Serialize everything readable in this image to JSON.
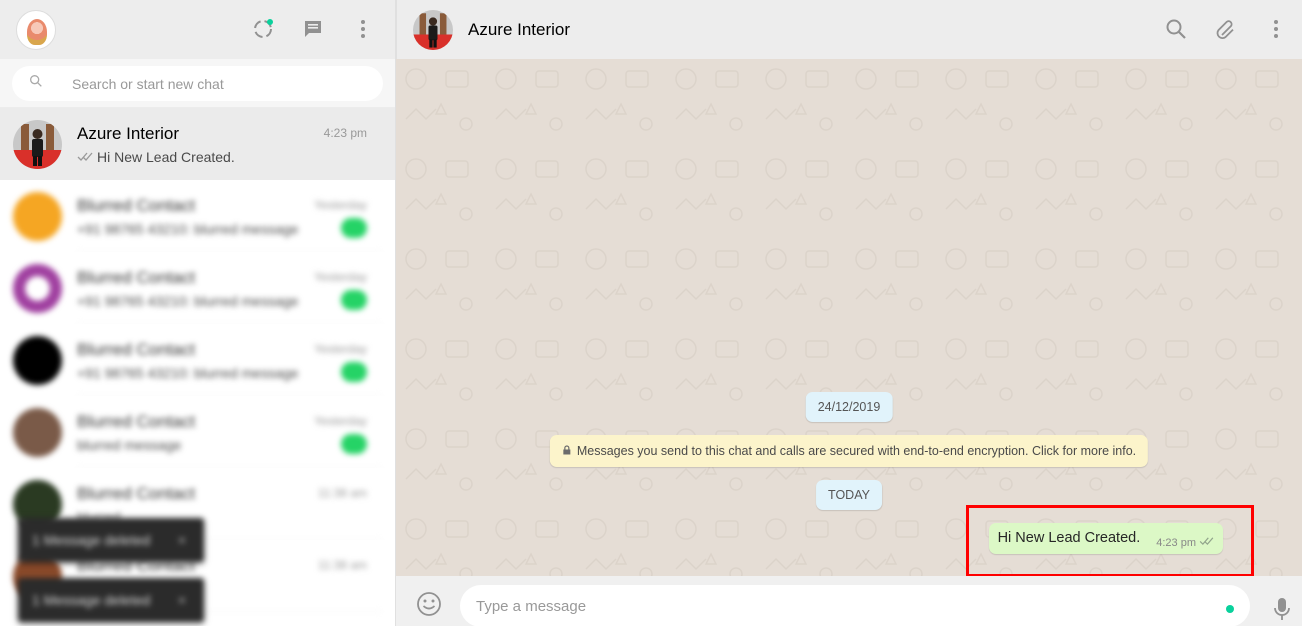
{
  "left_header": {
    "avatar_icon": "deity-avatar-icon",
    "status_icon": "status-icon",
    "new_chat_icon": "new-chat-icon",
    "menu_icon": "menu-icon"
  },
  "search": {
    "placeholder": "Search or start new chat",
    "icon": "search-icon"
  },
  "chats": [
    {
      "name": "Azure Interior",
      "time": "4:23 pm",
      "preview": "Hi New Lead Created.",
      "read_receipt": "double-tick-icon",
      "active": true
    },
    {
      "name": "Blurred Contact",
      "time": "Yesterday",
      "preview": "+91 98765 43210: blurred message",
      "blurred": true
    },
    {
      "name": "Blurred Contact",
      "time": "Yesterday",
      "preview": "+91 98765 43210: blurred message",
      "blurred": true
    },
    {
      "name": "Blurred Contact",
      "time": "Yesterday",
      "preview": "+91 98765 43210: blurred message",
      "blurred": true
    },
    {
      "name": "Blurred Contact",
      "time": "Yesterday",
      "preview": "blurred message",
      "blurred": true
    },
    {
      "name": "Blurred Contact",
      "time": "11:38 am",
      "preview": "blurred",
      "blurred": true
    },
    {
      "name": "Blurred Contact",
      "time": "11:38 am",
      "preview": "blurred message",
      "blurred": true
    }
  ],
  "toasts": [
    {
      "label": "1 Message deleted",
      "close": "×"
    },
    {
      "label": "1 Message deleted",
      "close": "×"
    }
  ],
  "conversation": {
    "contact_name": "Azure Interior",
    "date_chip": "24/12/2019",
    "encryption_notice": "Messages you send to this chat and calls are secured with end-to-end encryption. Click for more info.",
    "today_chip": "TODAY",
    "messages": [
      {
        "text": "Hi New Lead Created.",
        "time": "4:23 pm",
        "direction": "outgoing",
        "status": "double-tick-icon"
      }
    ]
  },
  "composer": {
    "placeholder": "Type a message",
    "emoji_icon": "emoji-icon",
    "mic_icon": "mic-icon"
  },
  "right_header": {
    "search_icon": "search-icon",
    "attach_icon": "paperclip-icon",
    "menu_icon": "menu-icon"
  },
  "colors": {
    "header_bg": "#ededed",
    "conversation_bg": "#e5ddd5",
    "outgoing_bubble": "#dcf8c6",
    "system_chip": "#e1f3fb",
    "encryption_bg": "#fcf4cb",
    "accent_green": "#25d366",
    "highlight": "#ff0000"
  }
}
